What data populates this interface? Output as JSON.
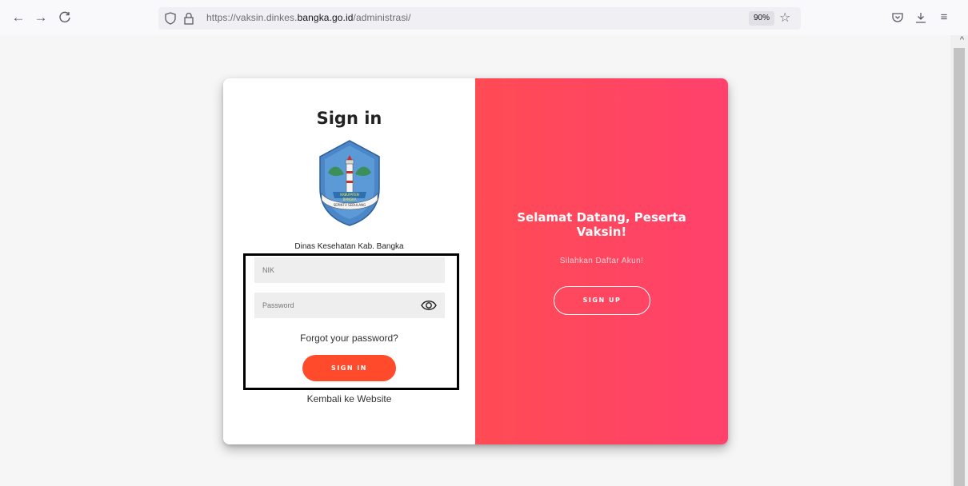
{
  "browser": {
    "url_prefix": "https://vaksin.dinkes.",
    "url_domain": "bangka.go.id",
    "url_path": "/administrasi/",
    "zoom": "90%",
    "icons": [
      "back-arrow-icon",
      "forward-arrow-icon",
      "reload-icon",
      "shield-icon",
      "lock-icon",
      "star-icon",
      "pocket-icon",
      "download-icon",
      "menu-icon"
    ]
  },
  "login": {
    "title": "Sign in",
    "org_name": "Dinas Kesehatan Kab. Bangka",
    "nik_placeholder": "NIK",
    "password_placeholder": "Password",
    "forgot_link": "Forgot your password?",
    "signin_button": "SIGN IN",
    "back_link": "Kembali ke Website"
  },
  "welcome_panel": {
    "heading": "Selamat Datang, Peserta Vaksin!",
    "subtext": "Silahkan Daftar Akun!",
    "signup_button": "SIGN UP"
  },
  "colors": {
    "accent_gradient_start": "#ff4b54",
    "accent_gradient_end": "#ff416c",
    "signin_button": "#ff4b2b"
  }
}
